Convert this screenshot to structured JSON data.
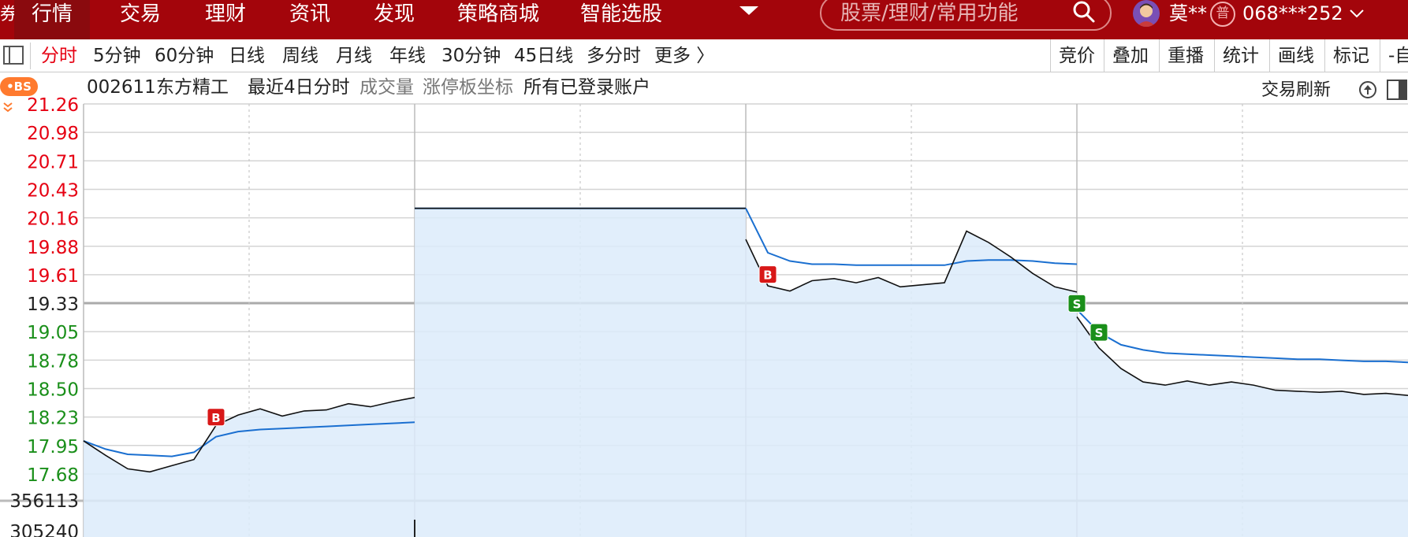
{
  "nav": {
    "logo_glyph": "券",
    "items": [
      {
        "label": "行情",
        "active": true
      },
      {
        "label": "交易"
      },
      {
        "label": "理财"
      },
      {
        "label": "资讯"
      },
      {
        "label": "发现"
      },
      {
        "label": "策略商城"
      },
      {
        "label": "智能选股"
      }
    ],
    "search_placeholder": "股票/理财/常用功能",
    "user_name": "莫**",
    "user_badge": "普",
    "account": "068***252",
    "colors": {
      "bar": "#a3050b",
      "active": "#8a0a0e"
    }
  },
  "toolbar": {
    "periods": [
      "分时",
      "5分钟",
      "60分钟",
      "日线",
      "周线",
      "月线",
      "年线",
      "30分钟",
      "45日线",
      "多分时",
      "更多 〉"
    ],
    "active_period": "分时",
    "tools": [
      "竞价",
      "叠加",
      "重播",
      "统计",
      "画线",
      "标记",
      "-自"
    ]
  },
  "info": {
    "bs_label": "•BS",
    "code": "002611",
    "name": "东方精工",
    "range": "最近4日分时",
    "volume": "成交量",
    "limit_axis": "涨停板坐标",
    "accounts": "所有已登录账户",
    "refresh": "交易刷新"
  },
  "chart_data": {
    "type": "line",
    "reference_price": 19.33,
    "price_ticks": [
      "21.26",
      "20.98",
      "20.71",
      "20.43",
      "20.16",
      "19.88",
      "19.61",
      "19.33",
      "19.05",
      "18.78",
      "18.50",
      "18.23",
      "17.95",
      "17.68"
    ],
    "volume_ticks": [
      "356113",
      "305240"
    ],
    "colors": {
      "up": "#e60012",
      "down": "#1a8f1a",
      "flat": "#222222",
      "price": "#111111",
      "avg": "#1a6fd0",
      "fill": "#dcebfa"
    },
    "days": [
      {
        "price": [
          18.0,
          17.86,
          17.73,
          17.7,
          17.76,
          17.82,
          18.15,
          18.25,
          18.31,
          18.24,
          18.29,
          18.3,
          18.36,
          18.33,
          18.38,
          18.42
        ],
        "avg": [
          18.0,
          17.92,
          17.87,
          17.86,
          17.85,
          17.89,
          18.04,
          18.09,
          18.11,
          18.12,
          18.13,
          18.14,
          18.15,
          18.16,
          18.17,
          18.18
        ]
      },
      {
        "price": [
          20.25,
          20.25,
          20.25,
          20.25,
          20.25,
          20.25,
          20.25,
          20.25,
          20.25,
          20.25,
          20.25,
          20.25,
          20.25,
          20.25,
          20.25,
          20.25
        ],
        "avg": [
          20.25,
          20.25,
          20.25,
          20.25,
          20.25,
          20.25,
          20.25,
          20.25,
          20.25,
          20.25,
          20.25,
          20.25,
          20.25,
          20.25,
          20.25,
          20.25
        ]
      },
      {
        "price": [
          19.95,
          19.5,
          19.45,
          19.55,
          19.57,
          19.53,
          19.58,
          19.49,
          19.51,
          19.53,
          20.03,
          19.92,
          19.78,
          19.62,
          19.49,
          19.44
        ],
        "avg": [
          20.25,
          19.82,
          19.74,
          19.71,
          19.71,
          19.7,
          19.7,
          19.7,
          19.7,
          19.7,
          19.74,
          19.75,
          19.75,
          19.74,
          19.72,
          19.71
        ]
      },
      {
        "price": [
          19.2,
          18.9,
          18.7,
          18.57,
          18.54,
          18.58,
          18.54,
          18.57,
          18.54,
          18.49,
          18.48,
          18.47,
          18.48,
          18.45,
          18.46,
          18.44
        ],
        "avg": [
          19.27,
          19.05,
          18.93,
          18.88,
          18.85,
          18.84,
          18.83,
          18.82,
          18.81,
          18.8,
          18.79,
          18.79,
          18.78,
          18.77,
          18.77,
          18.76
        ]
      }
    ],
    "trade_marks": [
      {
        "label": "B",
        "day": 1,
        "index": 6,
        "price": 18.23
      },
      {
        "label": "B",
        "day": 3,
        "index": 1,
        "price": 19.61
      },
      {
        "label": "S",
        "day": 3,
        "index": 15,
        "price": 19.33
      },
      {
        "label": "S",
        "day": 4,
        "index": 1,
        "price": 19.05
      }
    ]
  }
}
